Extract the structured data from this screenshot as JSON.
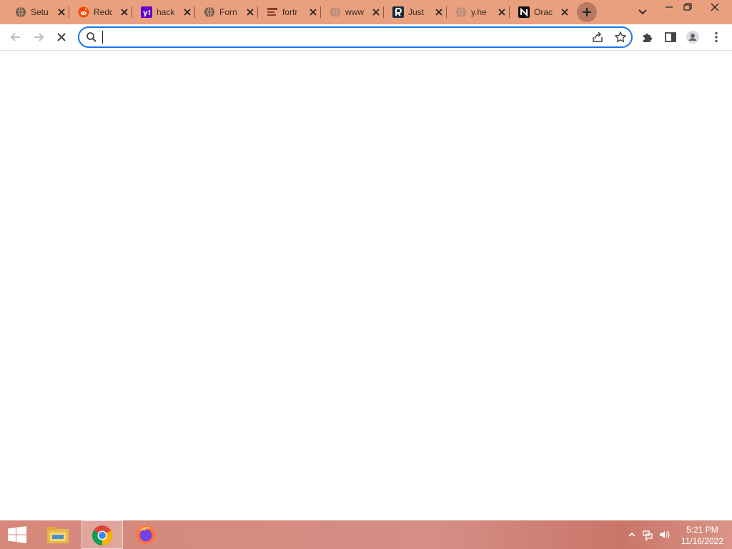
{
  "browser": {
    "tabs": [
      {
        "title": "Setu",
        "favicon": "globe-icon"
      },
      {
        "title": "Redd",
        "favicon": "reddit-icon"
      },
      {
        "title": "hack",
        "favicon": "yahoo-icon"
      },
      {
        "title": "Forn",
        "favicon": "globe-icon"
      },
      {
        "title": "fortr",
        "favicon": "search-results-icon"
      },
      {
        "title": "www.",
        "favicon": "globe-icon"
      },
      {
        "title": "Just",
        "favicon": "r-logo-icon"
      },
      {
        "title": "y.he",
        "favicon": "globe-icon"
      },
      {
        "title": "Orac",
        "favicon": "notion-icon"
      }
    ],
    "omnibox": {
      "value": "",
      "placeholder": ""
    },
    "colors": {
      "tabstrip": "#e9a07f",
      "focus_ring": "#1a73e8"
    }
  },
  "taskbar": {
    "apps": [
      "file-explorer-icon",
      "chrome-icon",
      "firefox-icon"
    ],
    "clock": {
      "time": "5:21 PM",
      "date": "11/16/2022"
    }
  }
}
